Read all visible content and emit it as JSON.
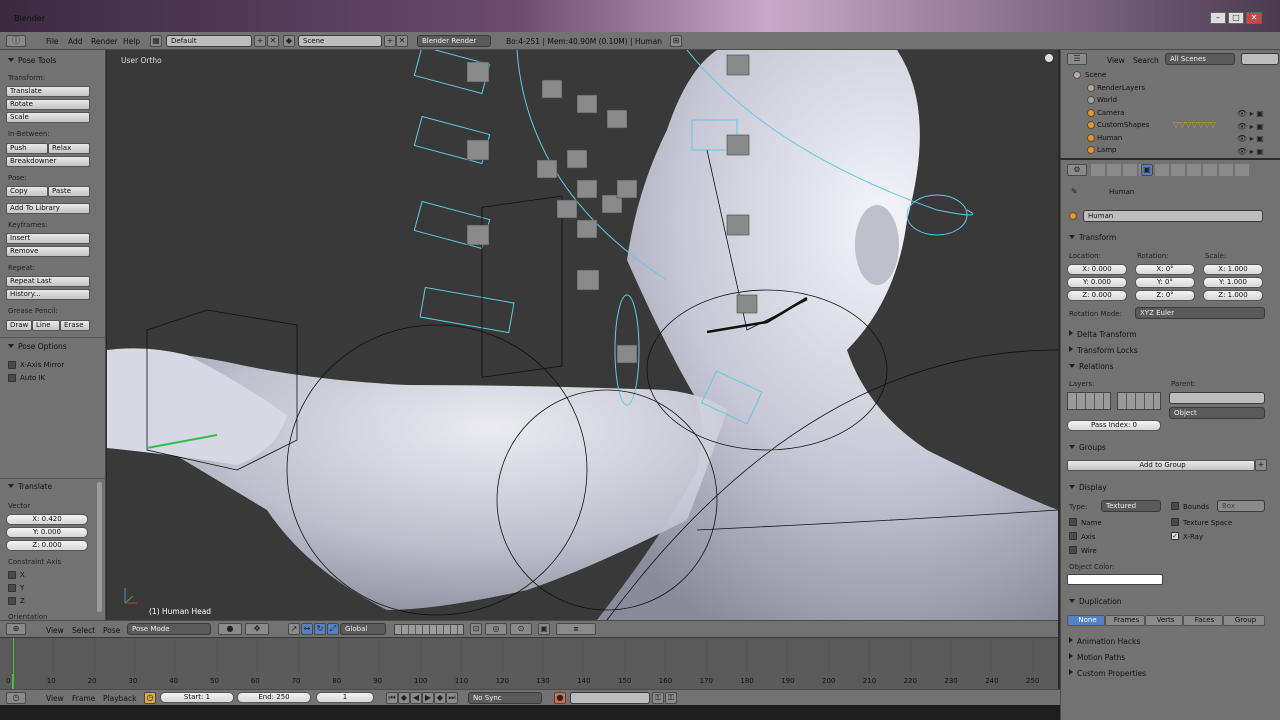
{
  "window": {
    "title": "Blender",
    "min": "–",
    "max": "□",
    "close": "✕"
  },
  "infobar": {
    "menus": [
      "File",
      "Add",
      "Render",
      "Help"
    ],
    "layout": "Default",
    "scene": "Scene",
    "engine": "Blender Render",
    "stats": "Bo:4-251 | Mem:40.90M (0.10M) | Human"
  },
  "tools": {
    "header": "Pose Tools",
    "transform_label": "Transform:",
    "translate": "Translate",
    "rotate": "Rotate",
    "scale": "Scale",
    "inbetween_label": "In-Between:",
    "push": "Push",
    "relax": "Relax",
    "breakdowner": "Breakdowner",
    "pose_label": "Pose:",
    "copy": "Copy",
    "paste": "Paste",
    "add_library": "Add To Library",
    "keyframes_label": "Keyframes:",
    "insert": "Insert",
    "remove": "Remove",
    "repeat_label": "Repeat:",
    "repeat_last": "Repeat Last",
    "history": "History...",
    "grease_label": "Grease Pencil:",
    "draw": "Draw",
    "line": "Line",
    "erase": "Erase",
    "pose_options": "Pose Options",
    "xaxis_mirror": "X-Axis Mirror",
    "auto_ik": "Auto IK"
  },
  "operator": {
    "header": "Translate",
    "vector_label": "Vector",
    "x": "X: 0.420",
    "y": "Y: 0.000",
    "z": "Z: 0.000",
    "constraint_label": "Constraint Axis",
    "cx": "X",
    "cy": "Y",
    "cz": "Z",
    "orientation_label": "Orientation"
  },
  "viewport": {
    "view_label": "User Ortho",
    "object_label": "(1) Human Head"
  },
  "viewheader": {
    "view": "View",
    "select": "Select",
    "pose": "Pose",
    "mode": "Pose Mode",
    "orientation": "Global"
  },
  "outliner": {
    "view": "View",
    "search": "Search",
    "scope": "All Scenes",
    "items": [
      "Scene",
      "RenderLayers",
      "World",
      "Camera",
      "CustomShapes",
      "Human",
      "Lamp"
    ]
  },
  "properties": {
    "object_name": "Human",
    "breadcrumb": "Human",
    "transform": "Transform",
    "location_label": "Location:",
    "rotation_label": "Rotation:",
    "scale_label": "Scale:",
    "loc": [
      "X: 0.000",
      "Y: 0.000",
      "Z: 0.000"
    ],
    "rot": [
      "X: 0°",
      "Y: 0°",
      "Z: 0°"
    ],
    "scl": [
      "X: 1.000",
      "Y: 1.000",
      "Z: 1.000"
    ],
    "rotation_mode_label": "Rotation Mode:",
    "rotation_mode": "XYZ Euler",
    "delta_transform": "Delta Transform",
    "transform_locks": "Transform Locks",
    "relations": "Relations",
    "layers_label": "Layers:",
    "parent_label": "Parent:",
    "parent_type": "Object",
    "pass_index": "Pass Index: 0",
    "groups": "Groups",
    "add_to_group": "Add to Group",
    "display": "Display",
    "type_label": "Type:",
    "type": "Textured",
    "bounds": "Bounds",
    "bounds_type": "Box",
    "name": "Name",
    "texture_space": "Texture Space",
    "axis": "Axis",
    "xray": "X-Ray",
    "wire": "Wire",
    "object_color_label": "Object Color:",
    "duplication": "Duplication",
    "dup_tabs": [
      "None",
      "Frames",
      "Verts",
      "Faces",
      "Group"
    ],
    "animation_hacks": "Animation Hacks",
    "motion_paths": "Motion Paths",
    "custom_properties": "Custom Properties"
  },
  "timeline": {
    "ticks": [
      "0",
      "10",
      "20",
      "30",
      "40",
      "50",
      "60",
      "70",
      "80",
      "90",
      "100",
      "110",
      "120",
      "130",
      "140",
      "150",
      "160",
      "170",
      "180",
      "190",
      "200",
      "210",
      "220",
      "230",
      "240",
      "250"
    ],
    "view": "View",
    "frame": "Frame",
    "playback": "Playback",
    "start": "Start: 1",
    "end": "End: 250",
    "current": "1",
    "sync": "No Sync"
  },
  "colors": {
    "accent": "#5680c2",
    "bone_wire": "#5ecbe6",
    "selected_bone": "#30c050"
  }
}
